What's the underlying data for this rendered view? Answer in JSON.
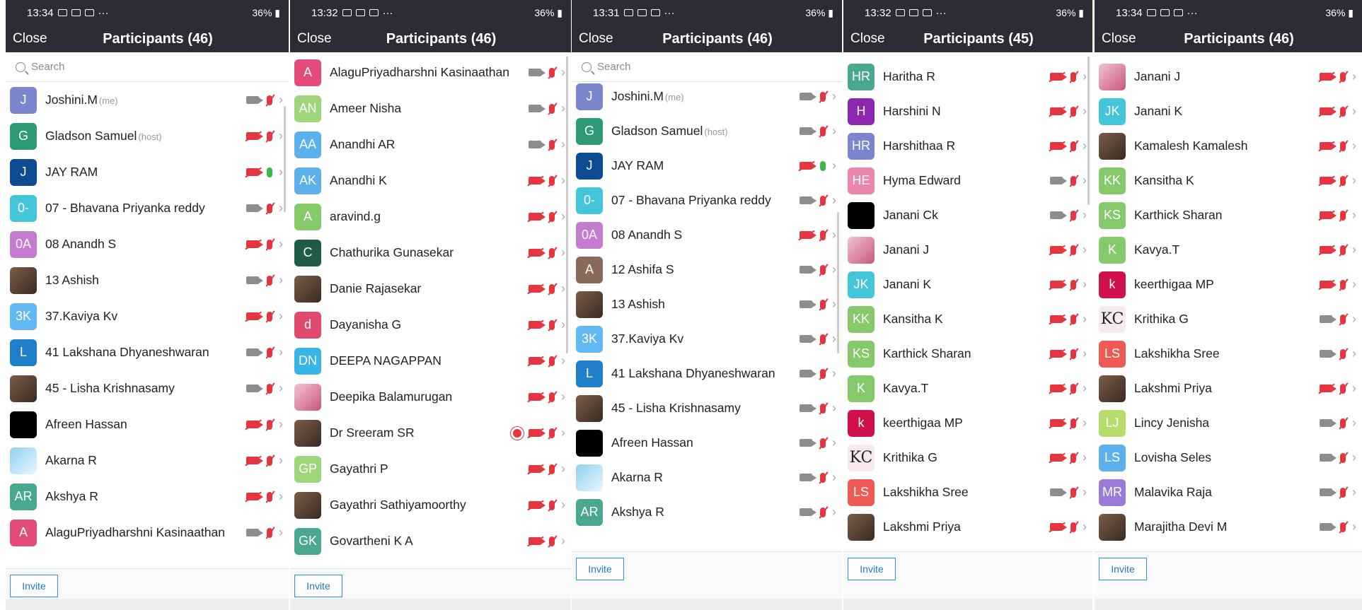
{
  "panels": [
    {
      "time": "13:34",
      "title": "Participants (46)",
      "close_label": "Close",
      "battery": "36%",
      "search_placeholder": "Search",
      "invite_label": "Invite",
      "rows": [
        {
          "initials": "J",
          "color": "#7b86cf",
          "name": "Joshini.M",
          "tag": "(me)",
          "cam": "on",
          "mic": "off"
        },
        {
          "initials": "G",
          "color": "#2e9a78",
          "name": "Gladson Samuel",
          "tag": "(host)",
          "cam": "off",
          "mic": "off"
        },
        {
          "initials": "J",
          "color": "#0d4b94",
          "name": "JAY RAM",
          "tag": "",
          "cam": "off",
          "mic": "on"
        },
        {
          "initials": "0-",
          "color": "#43c6d9",
          "name": "07 - Bhavana Priyanka reddy",
          "tag": "",
          "cam": "on",
          "mic": "off"
        },
        {
          "initials": "0A",
          "color": "#c57bd0",
          "name": "08 Anandh S",
          "tag": "",
          "cam": "off",
          "mic": "off"
        },
        {
          "initials": "",
          "avatar": "photo",
          "name": "13 Ashish",
          "tag": "",
          "cam": "on",
          "mic": "off"
        },
        {
          "initials": "3K",
          "color": "#62b8f0",
          "name": "37.Kaviya Kv",
          "tag": "",
          "cam": "off",
          "mic": "off"
        },
        {
          "initials": "L",
          "color": "#1f7fc9",
          "name": "41 Lakshana Dhyaneshwaran",
          "tag": "",
          "cam": "on",
          "mic": "off"
        },
        {
          "initials": "",
          "avatar": "photo",
          "name": "45 - Lisha Krishnasamy",
          "tag": "",
          "cam": "on",
          "mic": "off"
        },
        {
          "initials": "",
          "avatar": "black",
          "name": "Afreen Hassan",
          "tag": "",
          "cam": "off",
          "mic": "off"
        },
        {
          "initials": "",
          "avatar": "blue",
          "name": "Akarna R",
          "tag": "",
          "cam": "off",
          "mic": "off"
        },
        {
          "initials": "AR",
          "color": "#4aa890",
          "name": "Akshya R",
          "tag": "",
          "cam": "off",
          "mic": "off"
        },
        {
          "initials": "A",
          "color": "#e34b7b",
          "name": "AlaguPriyadharshni Kasinaathan",
          "tag": "",
          "cam": "on",
          "mic": "off"
        }
      ]
    },
    {
      "time": "13:32",
      "title": "Participants (46)",
      "close_label": "Close",
      "battery": "36%",
      "invite_label": "Invite",
      "rows": [
        {
          "initials": "A",
          "color": "#e34b7b",
          "name": "AlaguPriyadharshni Kasinaathan",
          "tag": "",
          "cam": "on",
          "mic": "off"
        },
        {
          "initials": "AN",
          "color": "#9fd67a",
          "name": "Ameer Nisha",
          "tag": "",
          "cam": "on",
          "mic": "off"
        },
        {
          "initials": "AA",
          "color": "#5cb0ec",
          "name": "Anandhi AR",
          "tag": "",
          "cam": "on",
          "mic": "off"
        },
        {
          "initials": "AK",
          "color": "#5cb0ec",
          "name": "Anandhi K",
          "tag": "",
          "cam": "off",
          "mic": "off"
        },
        {
          "initials": "A",
          "color": "#86c96b",
          "name": "aravind.g",
          "tag": "",
          "cam": "off",
          "mic": "off"
        },
        {
          "initials": "C",
          "color": "#1e5c48",
          "name": "Chathurika Gunasekar",
          "tag": "",
          "cam": "off",
          "mic": "off"
        },
        {
          "initials": "",
          "avatar": "photo",
          "name": "Danie Rajasekar",
          "tag": "",
          "cam": "off",
          "mic": "off"
        },
        {
          "initials": "d",
          "color": "#e14a6c",
          "name": "Dayanisha G",
          "tag": "",
          "cam": "off",
          "mic": "off"
        },
        {
          "initials": "DN",
          "color": "#39b4e6",
          "name": "DEEPA NAGAPPAN",
          "tag": "",
          "cam": "off",
          "mic": "off"
        },
        {
          "initials": "",
          "avatar": "pink",
          "name": "Deepika Balamurugan",
          "tag": "",
          "cam": "off",
          "mic": "off"
        },
        {
          "initials": "",
          "avatar": "photo",
          "name": "Dr Sreeram SR",
          "tag": "",
          "cam": "off",
          "mic": "off",
          "rec": true
        },
        {
          "initials": "GP",
          "color": "#9fd67a",
          "name": "Gayathri P",
          "tag": "",
          "cam": "off",
          "mic": "off"
        },
        {
          "initials": "",
          "avatar": "photo",
          "name": "Gayathri Sathiyamoorthy",
          "tag": "",
          "cam": "off",
          "mic": "off"
        },
        {
          "initials": "GK",
          "color": "#4aa890",
          "name": "Govartheni K A",
          "tag": "",
          "cam": "off",
          "mic": "off"
        }
      ]
    },
    {
      "time": "13:31",
      "title": "Participants (46)",
      "close_label": "Close",
      "battery": "36%",
      "search_placeholder": "Search",
      "invite_label": "Invite",
      "rows": [
        {
          "initials": "J",
          "color": "#7b86cf",
          "name": "Joshini.M",
          "tag": "(me)",
          "cam": "on",
          "mic": "off"
        },
        {
          "initials": "G",
          "color": "#2e9a78",
          "name": "Gladson Samuel",
          "tag": "(host)",
          "cam": "on",
          "mic": "off"
        },
        {
          "initials": "J",
          "color": "#0d4b94",
          "name": "JAY RAM",
          "tag": "",
          "cam": "off",
          "mic": "on"
        },
        {
          "initials": "0-",
          "color": "#43c6d9",
          "name": "07 - Bhavana Priyanka reddy",
          "tag": "",
          "cam": "on",
          "mic": "off"
        },
        {
          "initials": "0A",
          "color": "#c57bd0",
          "name": "08 Anandh S",
          "tag": "",
          "cam": "off",
          "mic": "off"
        },
        {
          "initials": "A",
          "color": "#8a6a5a",
          "name": "12 Ashifa S",
          "tag": "",
          "cam": "on",
          "mic": "off"
        },
        {
          "initials": "",
          "avatar": "photo",
          "name": "13 Ashish",
          "tag": "",
          "cam": "on",
          "mic": "off"
        },
        {
          "initials": "3K",
          "color": "#62b8f0",
          "name": "37.Kaviya Kv",
          "tag": "",
          "cam": "on",
          "mic": "off"
        },
        {
          "initials": "L",
          "color": "#1f7fc9",
          "name": "41 Lakshana Dhyaneshwaran",
          "tag": "",
          "cam": "on",
          "mic": "off"
        },
        {
          "initials": "",
          "avatar": "photo",
          "name": "45 - Lisha Krishnasamy",
          "tag": "",
          "cam": "on",
          "mic": "off"
        },
        {
          "initials": "",
          "avatar": "black",
          "name": "Afreen Hassan",
          "tag": "",
          "cam": "on",
          "mic": "off"
        },
        {
          "initials": "",
          "avatar": "blue",
          "name": "Akarna R",
          "tag": "",
          "cam": "on",
          "mic": "off"
        },
        {
          "initials": "AR",
          "color": "#4aa890",
          "name": "Akshya R",
          "tag": "",
          "cam": "on",
          "mic": "off"
        }
      ]
    },
    {
      "time": "13:32",
      "title": "Participants (45)",
      "close_label": "Close",
      "battery": "36%",
      "invite_label": "Invite",
      "rows": [
        {
          "initials": "HR",
          "color": "#4aa890",
          "name": "Haritha R",
          "tag": "",
          "cam": "off",
          "mic": "off"
        },
        {
          "initials": "H",
          "color": "#8e27b0",
          "name": "Harshini N",
          "tag": "",
          "cam": "off",
          "mic": "off"
        },
        {
          "initials": "HR",
          "color": "#7b86cf",
          "name": "Harshithaa R",
          "tag": "",
          "cam": "off",
          "mic": "off"
        },
        {
          "initials": "HE",
          "color": "#ec86ad",
          "name": "Hyma Edward",
          "tag": "",
          "cam": "on",
          "mic": "off"
        },
        {
          "initials": "",
          "avatar": "black",
          "name": "Janani Ck",
          "tag": "",
          "cam": "on",
          "mic": "off"
        },
        {
          "initials": "",
          "avatar": "pink",
          "name": "Janani J",
          "tag": "",
          "cam": "off",
          "mic": "off"
        },
        {
          "initials": "JK",
          "color": "#43c6d9",
          "name": "Janani K",
          "tag": "",
          "cam": "off",
          "mic": "off"
        },
        {
          "initials": "KK",
          "color": "#86c96b",
          "name": "Kansitha K",
          "tag": "",
          "cam": "off",
          "mic": "off"
        },
        {
          "initials": "KS",
          "color": "#86c96b",
          "name": "Karthick Sharan",
          "tag": "",
          "cam": "off",
          "mic": "off"
        },
        {
          "initials": "K",
          "color": "#86c96b",
          "name": "Kavya.T",
          "tag": "",
          "cam": "off",
          "mic": "off"
        },
        {
          "initials": "k",
          "color": "#d0104c",
          "name": "keerthigaa MP",
          "tag": "",
          "cam": "off",
          "mic": "off"
        },
        {
          "initials": "KC",
          "avatar": "kc",
          "name": "Krithika G",
          "tag": "",
          "cam": "off",
          "mic": "off"
        },
        {
          "initials": "LS",
          "color": "#ef5a55",
          "name": "Lakshikha Sree",
          "tag": "",
          "cam": "on",
          "mic": "off"
        },
        {
          "initials": "",
          "avatar": "photo",
          "name": "Lakshmi Priya",
          "tag": "",
          "cam": "off",
          "mic": "off"
        }
      ]
    },
    {
      "time": "13:34",
      "title": "Participants (46)",
      "close_label": "Close",
      "battery": "36%",
      "invite_label": "Invite",
      "rows": [
        {
          "initials": "",
          "avatar": "pink",
          "name": "Janani J",
          "tag": "",
          "cam": "off",
          "mic": "off"
        },
        {
          "initials": "JK",
          "color": "#43c6d9",
          "name": "Janani K",
          "tag": "",
          "cam": "off",
          "mic": "off"
        },
        {
          "initials": "",
          "avatar": "photo",
          "name": "Kamalesh Kamalesh",
          "tag": "",
          "cam": "off",
          "mic": "off"
        },
        {
          "initials": "KK",
          "color": "#86c96b",
          "name": "Kansitha K",
          "tag": "",
          "cam": "off",
          "mic": "off"
        },
        {
          "initials": "KS",
          "color": "#86c96b",
          "name": "Karthick Sharan",
          "tag": "",
          "cam": "off",
          "mic": "off"
        },
        {
          "initials": "K",
          "color": "#86c96b",
          "name": "Kavya.T",
          "tag": "",
          "cam": "off",
          "mic": "off"
        },
        {
          "initials": "k",
          "color": "#d0104c",
          "name": "keerthigaa MP",
          "tag": "",
          "cam": "off",
          "mic": "off"
        },
        {
          "initials": "KC",
          "avatar": "kc",
          "name": "Krithika G",
          "tag": "",
          "cam": "on",
          "mic": "off"
        },
        {
          "initials": "LS",
          "color": "#ef5a55",
          "name": "Lakshikha Sree",
          "tag": "",
          "cam": "on",
          "mic": "off"
        },
        {
          "initials": "",
          "avatar": "photo",
          "name": "Lakshmi Priya",
          "tag": "",
          "cam": "off",
          "mic": "off"
        },
        {
          "initials": "LJ",
          "color": "#b6dc6c",
          "name": "Lincy Jenisha",
          "tag": "",
          "cam": "on",
          "mic": "off"
        },
        {
          "initials": "LS",
          "color": "#5cb0ec",
          "name": "Lovisha Seles",
          "tag": "",
          "cam": "on",
          "mic": "off"
        },
        {
          "initials": "MR",
          "color": "#9a7bd8",
          "name": "Malavika Raja",
          "tag": "",
          "cam": "on",
          "mic": "off"
        },
        {
          "initials": "",
          "avatar": "photo",
          "name": "Marajitha Devi M",
          "tag": "",
          "cam": "on",
          "mic": "off"
        }
      ]
    }
  ]
}
